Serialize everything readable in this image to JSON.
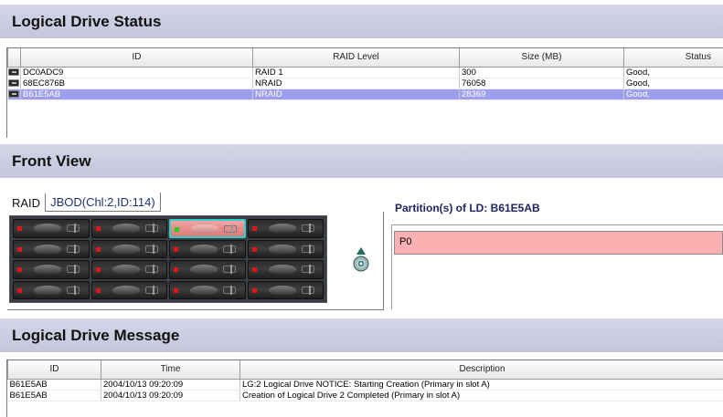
{
  "status_section": {
    "title": "Logical Drive Status",
    "columns": [
      "ID",
      "RAID Level",
      "Size (MB)",
      "Status"
    ],
    "rows": [
      {
        "id": "DC0ADC9",
        "raid": "RAID 1",
        "size": "300",
        "status": "Good,"
      },
      {
        "id": "68EC876B",
        "raid": "NRAID",
        "size": "76058",
        "status": "Good,"
      },
      {
        "id": "B61E5AB",
        "raid": "NRAID",
        "size": "28369",
        "status": "Good,"
      }
    ],
    "selected_row": 2
  },
  "front_view": {
    "title": "Front View",
    "tabs": [
      "RAID",
      "JBOD(Chl:2,ID:114)"
    ],
    "active_tab": "RAID",
    "partition_title": "Partition(s) of LD: B61E5AB",
    "partition_label": "P0",
    "selected_slot_color": "#e88f8f",
    "slot_led_color": "#e01515",
    "selected_led_color": "#1ed21e",
    "selected_slot_index": 2
  },
  "message_section": {
    "title": "Logical Drive Message",
    "columns": [
      "ID",
      "Time",
      "Description"
    ],
    "rows": [
      {
        "id": "B61E5AB",
        "time": "2004/10/13 09:20:09",
        "desc": "LG:2 Logical Drive NOTICE: Starting Creation (Primary in slot A)"
      },
      {
        "id": "B61E5AB",
        "time": "2004/10/13 09:20:09",
        "desc": "Creation of Logical Drive 2 Completed (Primary in slot A)"
      }
    ]
  },
  "colors": {
    "header_bg": "#c8c9e0",
    "selection": "#9e9eef",
    "partition": "#fbb1b1"
  }
}
